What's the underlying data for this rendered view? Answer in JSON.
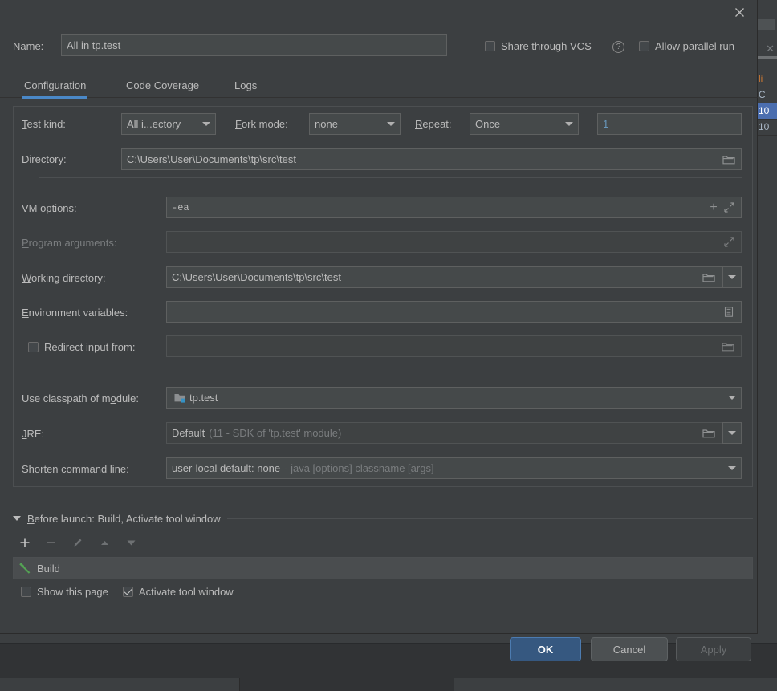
{
  "window": {
    "close_icon": "close-icon"
  },
  "name_row": {
    "label": "Name:",
    "label_mnemonic": "N",
    "value": "All in tp.test",
    "share_vcs_label": "Share through VCS",
    "share_vcs_mnemonic": "S",
    "share_vcs_checked": false,
    "help_icon": "help-icon",
    "help_glyph": "?",
    "allow_parallel_label": "Allow parallel run",
    "allow_parallel_mnemonic": "u",
    "allow_parallel_checked": false
  },
  "tabs": [
    {
      "label": "Configuration",
      "active": true
    },
    {
      "label": "Code Coverage",
      "active": false
    },
    {
      "label": "Logs",
      "active": false
    }
  ],
  "configuration": {
    "test_kind": {
      "label": "Test kind:",
      "label_mnemonic": "T",
      "value": "All i...ectory"
    },
    "fork_mode": {
      "label": "Fork mode:",
      "label_mnemonic": "F",
      "value": "none"
    },
    "repeat": {
      "label": "Repeat:",
      "label_mnemonic": "R",
      "value": "Once",
      "count": "1"
    },
    "directory": {
      "label": "Directory:",
      "value": "C:\\Users\\User\\Documents\\tp\\src\\test",
      "browse_icon": "folder-icon"
    },
    "vm_options": {
      "label": "VM options:",
      "label_mnemonic": "V",
      "value": "-ea",
      "add_icon": "plus-icon",
      "expand_icon": "expand-icon"
    },
    "program_arguments": {
      "label": "Program arguments:",
      "label_mnemonic": "P",
      "value": "",
      "expand_icon": "expand-icon",
      "disabled": true
    },
    "working_directory": {
      "label": "Working directory:",
      "label_mnemonic": "W",
      "value": "C:\\Users\\User\\Documents\\tp\\src\\test",
      "browse_icon": "folder-icon",
      "dropdown_icon": "chevron-down-icon"
    },
    "environment_variables": {
      "label": "Environment variables:",
      "label_mnemonic": "E",
      "value": "",
      "editor_icon": "list-editor-icon"
    },
    "redirect_input": {
      "label": "Redirect input from:",
      "checked": false,
      "value": "",
      "browse_icon": "folder-icon"
    },
    "classpath_module": {
      "label": "Use classpath of module:",
      "label_mnemonic": "o",
      "value": "tp.test",
      "module_icon": "module-folder-icon",
      "dropdown_icon": "chevron-down-icon"
    },
    "jre": {
      "label": "JRE:",
      "label_mnemonic": "J",
      "value": "Default",
      "hint": "(11 - SDK of 'tp.test' module)",
      "browse_icon": "folder-icon",
      "dropdown_icon": "chevron-down-icon"
    },
    "shorten_command_line": {
      "label": "Shorten command line:",
      "label_mnemonic": "l",
      "value": "user-local default: none",
      "hint": "- java [options] classname [args]",
      "dropdown_icon": "chevron-down-icon"
    }
  },
  "before_launch": {
    "title": "Before launch: Build, Activate tool window",
    "title_mnemonic": "B",
    "expanded": true,
    "toolbar": [
      {
        "name": "add-button",
        "glyph": "+",
        "enabled": true
      },
      {
        "name": "remove-button",
        "glyph": "−",
        "enabled": false
      },
      {
        "name": "edit-button",
        "glyph": "pencil-icon",
        "enabled": false
      },
      {
        "name": "move-up-button",
        "glyph": "▲",
        "enabled": false
      },
      {
        "name": "move-down-button",
        "glyph": "▼",
        "enabled": false
      }
    ],
    "tasks": [
      {
        "label": "Build",
        "icon": "hammer-icon"
      }
    ],
    "show_this_page": {
      "label": "Show this page",
      "checked": false
    },
    "activate_tool_window": {
      "label": "Activate tool window",
      "checked": true
    }
  },
  "buttons": {
    "ok": "OK",
    "cancel": "Cancel",
    "apply": "Apply"
  },
  "background": {
    "cells": [
      "10",
      "10"
    ]
  },
  "colors": {
    "dialog_bg": "#3C3F41",
    "field_bg": "#45494A",
    "field_border": "#5E6060",
    "text": "#BBBBBB",
    "dim_text": "#7A7D7F",
    "accent_blue": "#4A88C7",
    "ok_button": "#365880",
    "selection_blue": "#4B6EAF",
    "build_green": "#54A254",
    "module_badge": "#3592C4"
  }
}
